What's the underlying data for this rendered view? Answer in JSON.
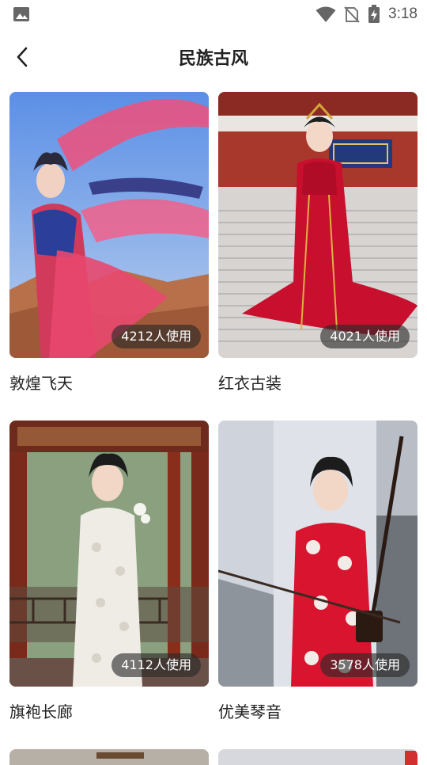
{
  "status_bar": {
    "time": "3:18",
    "icons": [
      "gallery-icon",
      "wifi-icon",
      "no-sim-icon",
      "battery-charging-icon"
    ]
  },
  "header": {
    "back_icon": "chevron-left-icon",
    "title": "民族古风"
  },
  "templates": [
    {
      "name": "敦煌飞天",
      "usage": "4212人使用",
      "colors": {
        "sky": "#6f9ae6",
        "ground": "#c27a52",
        "dress": "#d23a5c"
      }
    },
    {
      "name": "红衣古装",
      "usage": "4021人使用",
      "colors": {
        "sky": "#c8c8c8",
        "ground": "#bdbdbd",
        "dress": "#c8102e"
      }
    },
    {
      "name": "旗袍长廊",
      "usage": "4112人使用",
      "colors": {
        "sky": "#8fa98a",
        "ground": "#7a3a2a",
        "dress": "#f1eee8"
      }
    },
    {
      "name": "优美琴音",
      "usage": "3578人使用",
      "colors": {
        "sky": "#dfe3ea",
        "ground": "#9aa0a8",
        "dress": "#d9142f"
      }
    }
  ]
}
